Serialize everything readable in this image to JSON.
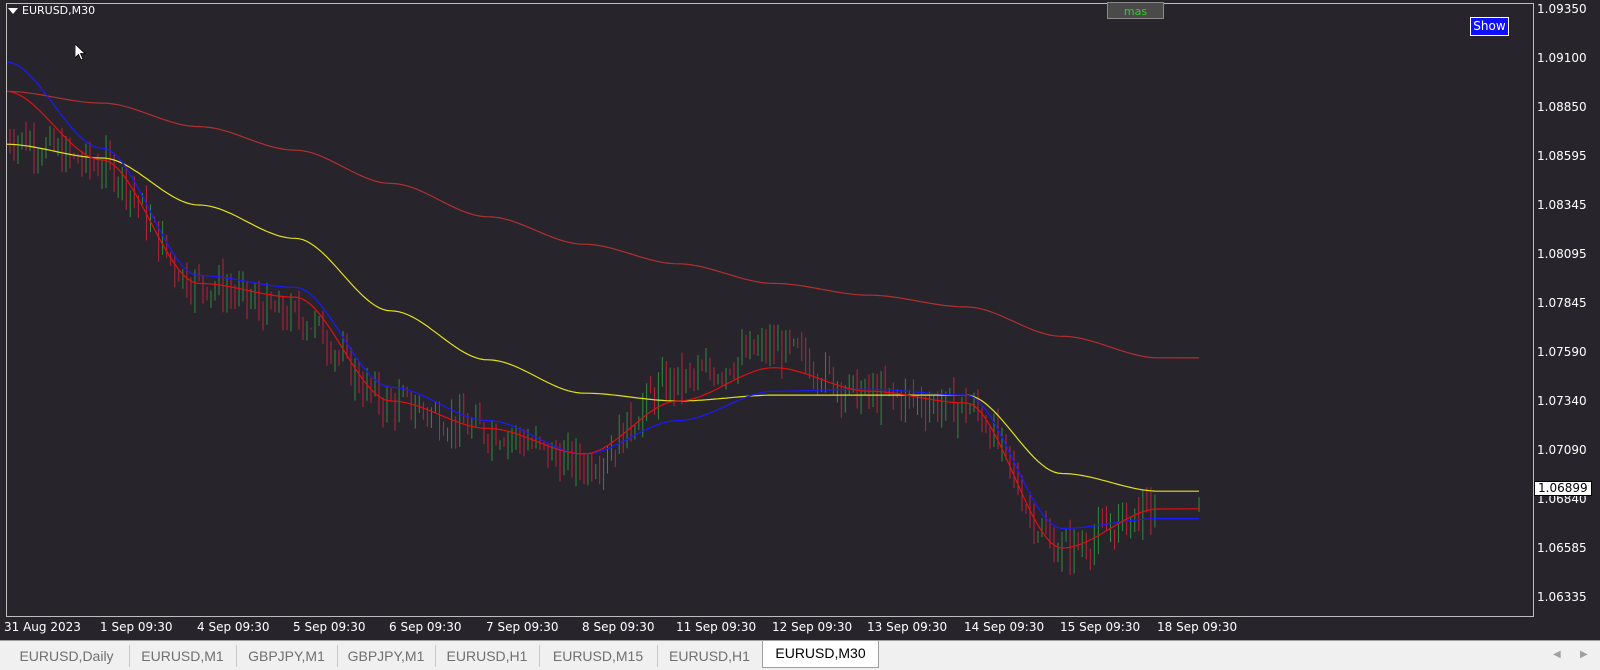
{
  "window": {
    "title": "EURUSD,M30"
  },
  "buttons": {
    "mas": "mas",
    "show": "Show"
  },
  "price_axis": [
    "1.09350",
    "1.09100",
    "1.08850",
    "1.08595",
    "1.08345",
    "1.08095",
    "1.07845",
    "1.07590",
    "1.07340",
    "1.07090",
    "1.06840",
    "1.06585",
    "1.06335"
  ],
  "current_price": "1.06899",
  "date_axis": [
    "31 Aug 2023",
    "1 Sep 09:30",
    "4 Sep 09:30",
    "5 Sep 09:30",
    "6 Sep 09:30",
    "7 Sep 09:30",
    "8 Sep 09:30",
    "11 Sep 09:30",
    "12 Sep 09:30",
    "13 Sep 09:30",
    "14 Sep 09:30",
    "15 Sep 09:30",
    "18 Sep 09:30"
  ],
  "tabs": [
    {
      "label": "EURUSD,Daily",
      "active": false
    },
    {
      "label": "EURUSD,M1",
      "active": false
    },
    {
      "label": "GBPJPY,M1",
      "active": false
    },
    {
      "label": "GBPJPY,M1",
      "active": false
    },
    {
      "label": "EURUSD,H1",
      "active": false
    },
    {
      "label": "EURUSD,M15",
      "active": false
    },
    {
      "label": "EURUSD,H1",
      "active": false
    },
    {
      "label": "EURUSD,M30",
      "active": true
    }
  ],
  "colors": {
    "background": "#28242c",
    "bull": "#2e8b3a",
    "bear": "#c0203a",
    "ma_slow": "#b03030",
    "ma_yellow": "#e0e020",
    "ma_blue": "#1a1aff",
    "ma_red": "#e01010"
  },
  "chart_data": {
    "type": "line",
    "symbol": "EURUSD",
    "timeframe": "M30",
    "ylim": [
      1.0622,
      1.0943
    ],
    "x": [
      "31 Aug 2023",
      "1 Sep 09:30",
      "4 Sep 09:30",
      "5 Sep 09:30",
      "6 Sep 09:30",
      "7 Sep 09:30",
      "8 Sep 09:30",
      "11 Sep 09:30",
      "12 Sep 09:30",
      "13 Sep 09:30",
      "14 Sep 09:30",
      "15 Sep 09:30",
      "18 Sep 09:30"
    ],
    "price": [
      1.087,
      1.0855,
      1.0795,
      1.0778,
      1.0734,
      1.072,
      1.0703,
      1.0745,
      1.0762,
      1.0738,
      1.0732,
      1.066,
      1.068
    ],
    "series": [
      {
        "values": [
          1.0893,
          1.0887,
          1.0875,
          1.0863,
          1.0846,
          1.0829,
          1.0815,
          1.0805,
          1.0795,
          1.0789,
          1.0783,
          1.0768,
          1.0757
        ]
      },
      {
        "values": [
          1.0866,
          1.0859,
          1.0835,
          1.0818,
          1.0781,
          1.0756,
          1.0739,
          1.0735,
          1.0738,
          1.0738,
          1.0738,
          1.0698,
          1.0689
        ]
      },
      {
        "values": [
          1.0908,
          1.0864,
          1.0799,
          1.0793,
          1.0742,
          1.0725,
          1.0708,
          1.0725,
          1.074,
          1.0741,
          1.0738,
          1.067,
          1.0675
        ]
      },
      {
        "values": [
          1.0893,
          1.0858,
          1.0795,
          1.0788,
          1.0735,
          1.0721,
          1.0708,
          1.0735,
          1.0752,
          1.074,
          1.0734,
          1.066,
          1.068
        ]
      }
    ]
  }
}
